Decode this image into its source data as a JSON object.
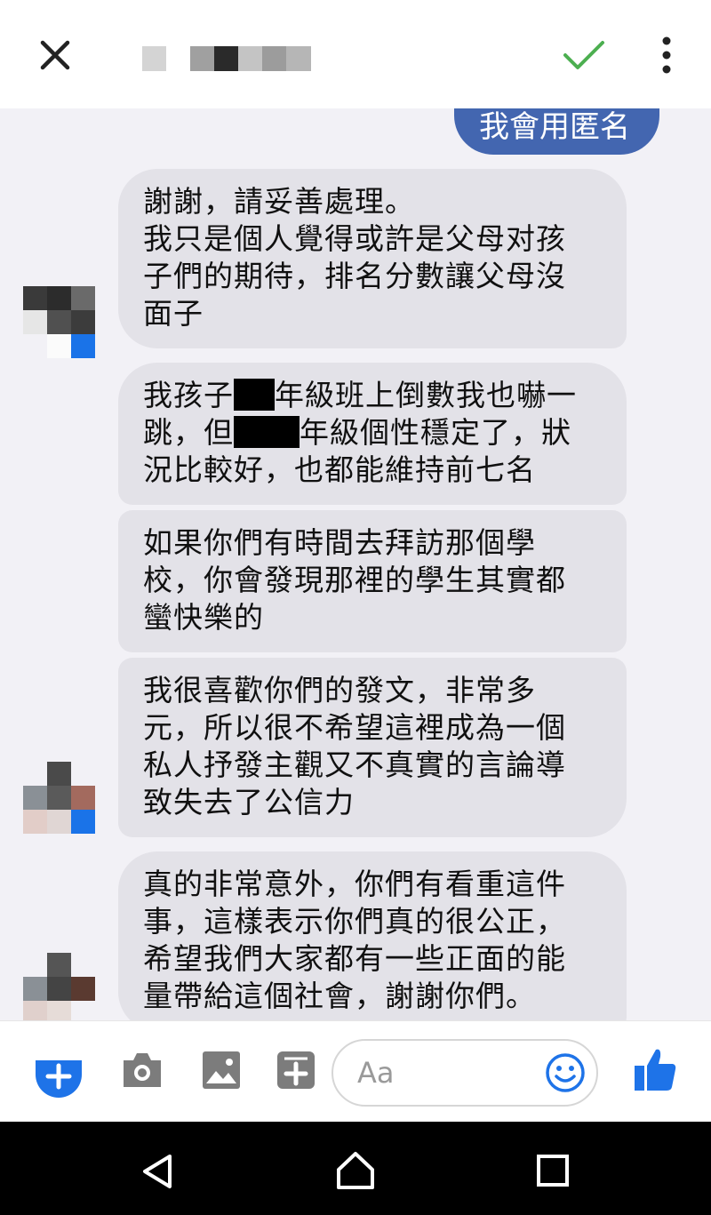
{
  "header": {
    "title_redacted": true,
    "icons": [
      "close-icon",
      "checkmark-icon",
      "more-vertical-icon"
    ],
    "check_color": "#4caf50"
  },
  "chat": {
    "sent_message": "我會用匿名",
    "bubble1": [
      "謝謝，請妥善處理。",
      "我只是個人覺得或許是父母对孩",
      "子們的期待，排名分數讓父母沒",
      "面子"
    ],
    "bubble2": {
      "l1a": "我孩子",
      "l1b": "年級班上倒數我也嚇一",
      "l2a": "跳，但",
      "l2b": "年級個性穩定了，狀",
      "l3": "況比較好，也都能維持前七名"
    },
    "bubble3": [
      "如果你們有時間去拜訪那個學",
      "校，你會發現那裡的學生其實都",
      "蠻快樂的"
    ],
    "bubble4": [
      "我很喜歡你們的發文，非常多",
      "元，所以很不希望這裡成為一個",
      "私人抒發主觀又不真實的言論導",
      "致失去了公信力"
    ],
    "bubble5": [
      "真的非常意外，你們有看重這件",
      "事，這樣表示你們真的很公正，",
      "希望我們大家都有一些正面的能",
      "量帶給這個社會，謝謝你們。"
    ]
  },
  "composer": {
    "placeholder": "Aa",
    "icons": [
      "menu-plus-icon",
      "camera-icon",
      "gallery-icon",
      "sticker-add-icon",
      "emoji-icon",
      "like-icon"
    ],
    "accent": "#1e73e8"
  },
  "navbar": {
    "icons": [
      "back-icon",
      "home-icon",
      "recents-icon"
    ]
  }
}
